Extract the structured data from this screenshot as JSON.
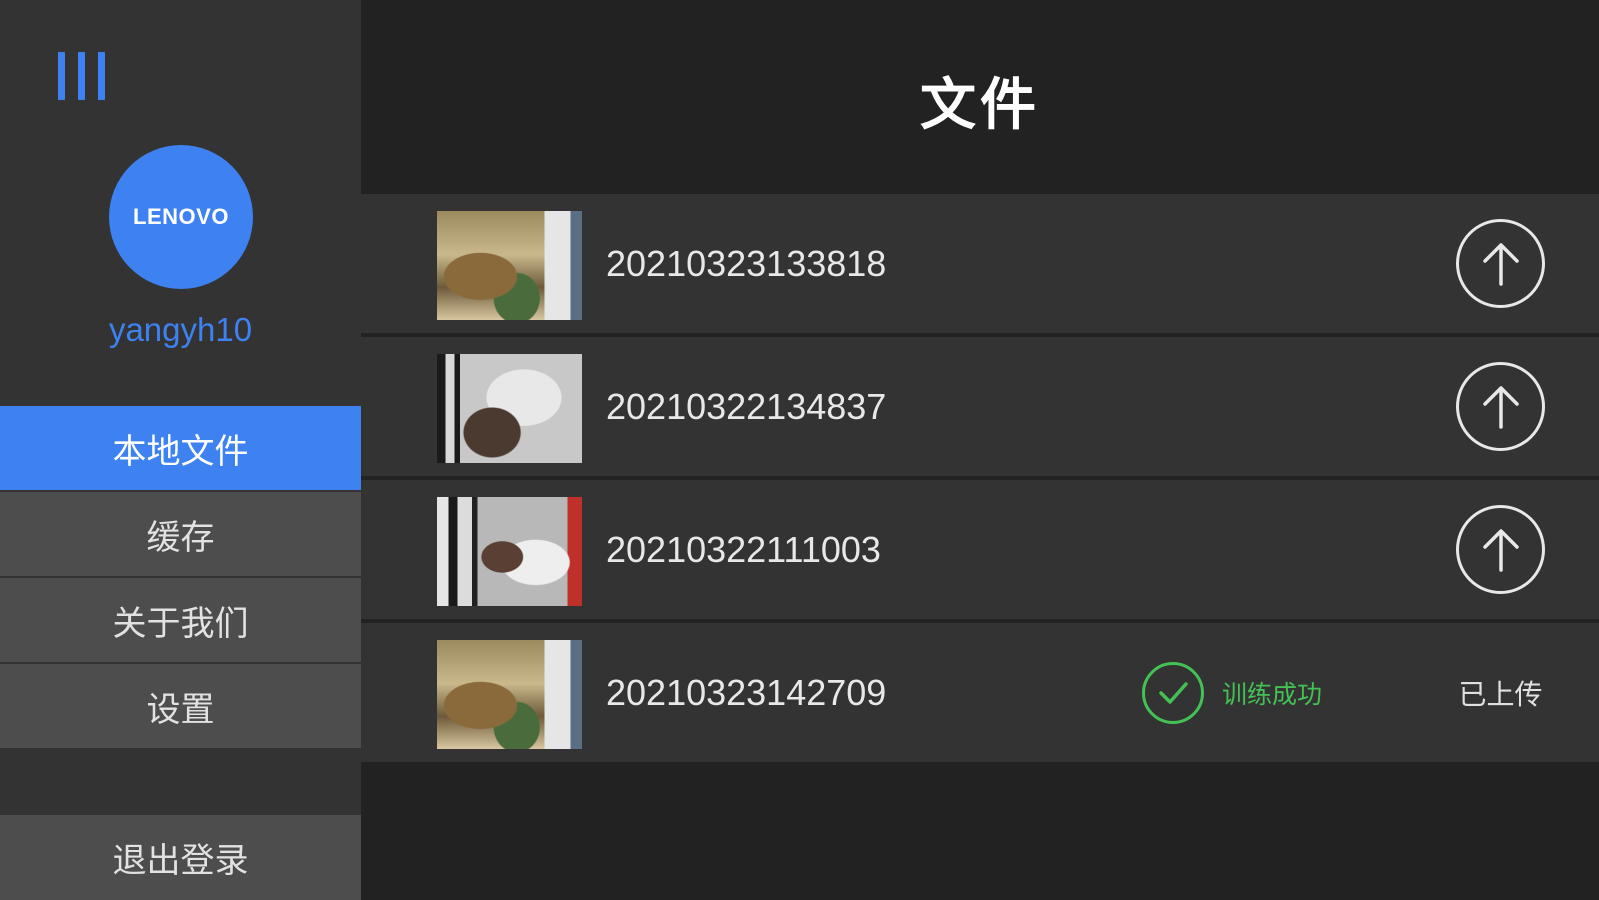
{
  "sidebar": {
    "avatar_text": "LENOVO",
    "username": "yangyh10",
    "menu_items": [
      "本地文件",
      "缓存",
      "关于我们",
      "设置"
    ],
    "active_item": "本地文件",
    "logout_label": "退出登录"
  },
  "main": {
    "title": "文件",
    "files": [
      {
        "name": "20210323133818",
        "state": "upload"
      },
      {
        "name": "20210322134837",
        "state": "upload"
      },
      {
        "name": "20210322111003",
        "state": "upload"
      },
      {
        "name": "20210323142709",
        "state": "uploaded",
        "status_text": "训练成功",
        "uploaded_label": "已上传"
      }
    ]
  },
  "colors": {
    "accent": "#3d82f0",
    "success": "#44c155",
    "sidebar_bg": "#333333",
    "page_bg": "#222222"
  },
  "icons": {
    "menu": "menu-bars-icon",
    "upload": "upload-arrow-icon",
    "success": "check-circle-icon"
  }
}
